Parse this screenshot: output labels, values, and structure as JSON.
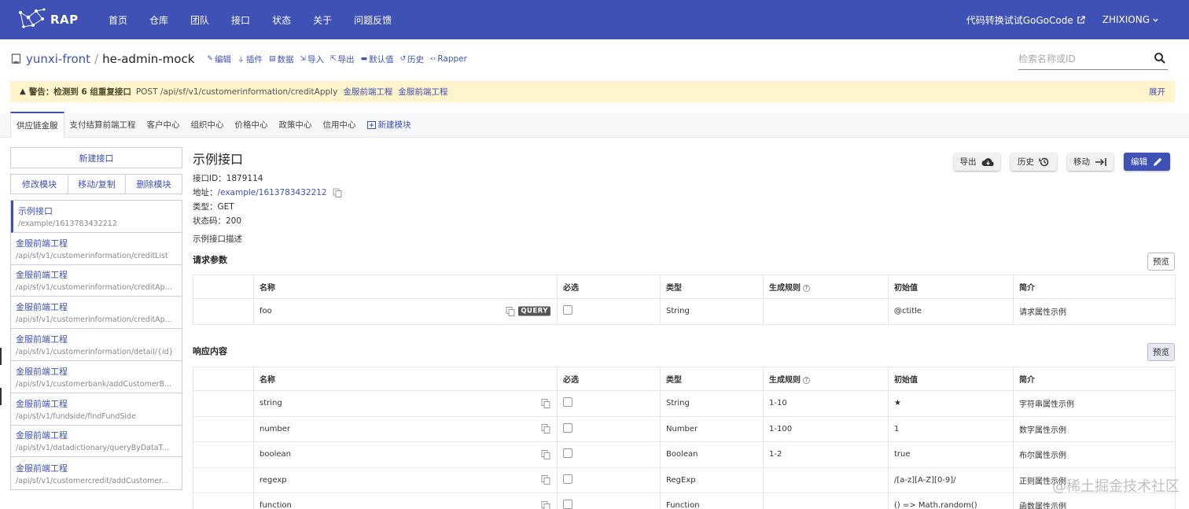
{
  "nav": {
    "logo_text": "RAP",
    "items": [
      "首页",
      "仓库",
      "团队",
      "接口",
      "状态",
      "关于",
      "问题反馈"
    ],
    "gogocode": "代码转换试试GoGoCode",
    "user": "ZHIXIONG"
  },
  "repo": {
    "org": "yunxi-front",
    "separator": "/",
    "name": "he-admin-mock",
    "actions": [
      "编辑",
      "插件",
      "数据",
      "导入",
      "导出",
      "默认值",
      "历史",
      "Rapper"
    ],
    "search_placeholder": "检索名称或ID"
  },
  "warning": {
    "strong": "警告：检测到 6 组重复接口",
    "text": "POST /api/sf/v1/customerinformation/creditApply",
    "links": [
      "金服前端工程",
      "金服前端工程"
    ],
    "expand": "展开"
  },
  "tabs": [
    "供应链金服",
    "支付结算前端工程",
    "客户中心",
    "组织中心",
    "价格中心",
    "政策中心",
    "信用中心",
    "新建模块"
  ],
  "sidebar": {
    "new_interface": "新建接口",
    "modify_module": "修改模块",
    "move_copy": "移动/复制",
    "delete_module": "删除模块",
    "items": [
      {
        "name": "示例接口",
        "url": "/example/1613783432212"
      },
      {
        "name": "金服前端工程",
        "url": "/api/sf/v1/customerinformation/creditList"
      },
      {
        "name": "金服前端工程",
        "url": "/api/sf/v1/customerinformation/creditAp..."
      },
      {
        "name": "金服前端工程",
        "url": "/api/sf/v1/customerinformation/creditAp..."
      },
      {
        "name": "金服前端工程",
        "url": "/api/sf/v1/customerinformation/detail/{id}"
      },
      {
        "name": "金服前端工程",
        "url": "/api/sf/v1/customerbank/addCustomerB..."
      },
      {
        "name": "金服前端工程",
        "url": "/api/sf/v1/fundside/findFundSide"
      },
      {
        "name": "金服前端工程",
        "url": "/api/sf/v1/datadictionary/queryByDataT..."
      },
      {
        "name": "金服前端工程",
        "url": "/api/sf/v1/customercredit/addCustomer..."
      }
    ]
  },
  "interface": {
    "title": "示例接口",
    "id_label": "接口ID：",
    "id": "1879114",
    "url_label": "地址：",
    "url": "/example/1613783432212",
    "type_label": "类型：",
    "type": "GET",
    "status_label": "状态码：",
    "status": "200",
    "desc": "示例接口描述"
  },
  "actions": {
    "export": "导出",
    "history": "历史",
    "move": "移动",
    "edit": "编辑"
  },
  "request": {
    "title": "请求参数",
    "preview": "预览",
    "headers": [
      "名称",
      "必选",
      "类型",
      "生成规则",
      "初始值",
      "简介"
    ],
    "rows": [
      {
        "name": "foo",
        "tag": "QUERY",
        "type": "String",
        "rule": "",
        "init": "@ctitle",
        "desc": "请求属性示例"
      }
    ]
  },
  "response": {
    "title": "响应内容",
    "preview": "预览",
    "headers": [
      "名称",
      "必选",
      "类型",
      "生成规则",
      "初始值",
      "简介"
    ],
    "rows": [
      {
        "name": "string",
        "type": "String",
        "rule": "1-10",
        "init": "★",
        "desc": "字符串属性示例"
      },
      {
        "name": "number",
        "type": "Number",
        "rule": "1-100",
        "init": "1",
        "desc": "数字属性示例"
      },
      {
        "name": "boolean",
        "type": "Boolean",
        "rule": "1-2",
        "init": "true",
        "desc": "布尔属性示例"
      },
      {
        "name": "regexp",
        "type": "RegExp",
        "rule": "",
        "init": "/[a-z][A-Z][0-9]/",
        "desc": "正则属性示例"
      },
      {
        "name": "function",
        "type": "Function",
        "rule": "",
        "init": "() => Math.random()",
        "desc": "函数属性示例"
      }
    ]
  },
  "watermark": "@稀土掘金技术社区",
  "colors": {
    "primary": "#3f51b5",
    "warning_bg": "#fff4cc"
  }
}
